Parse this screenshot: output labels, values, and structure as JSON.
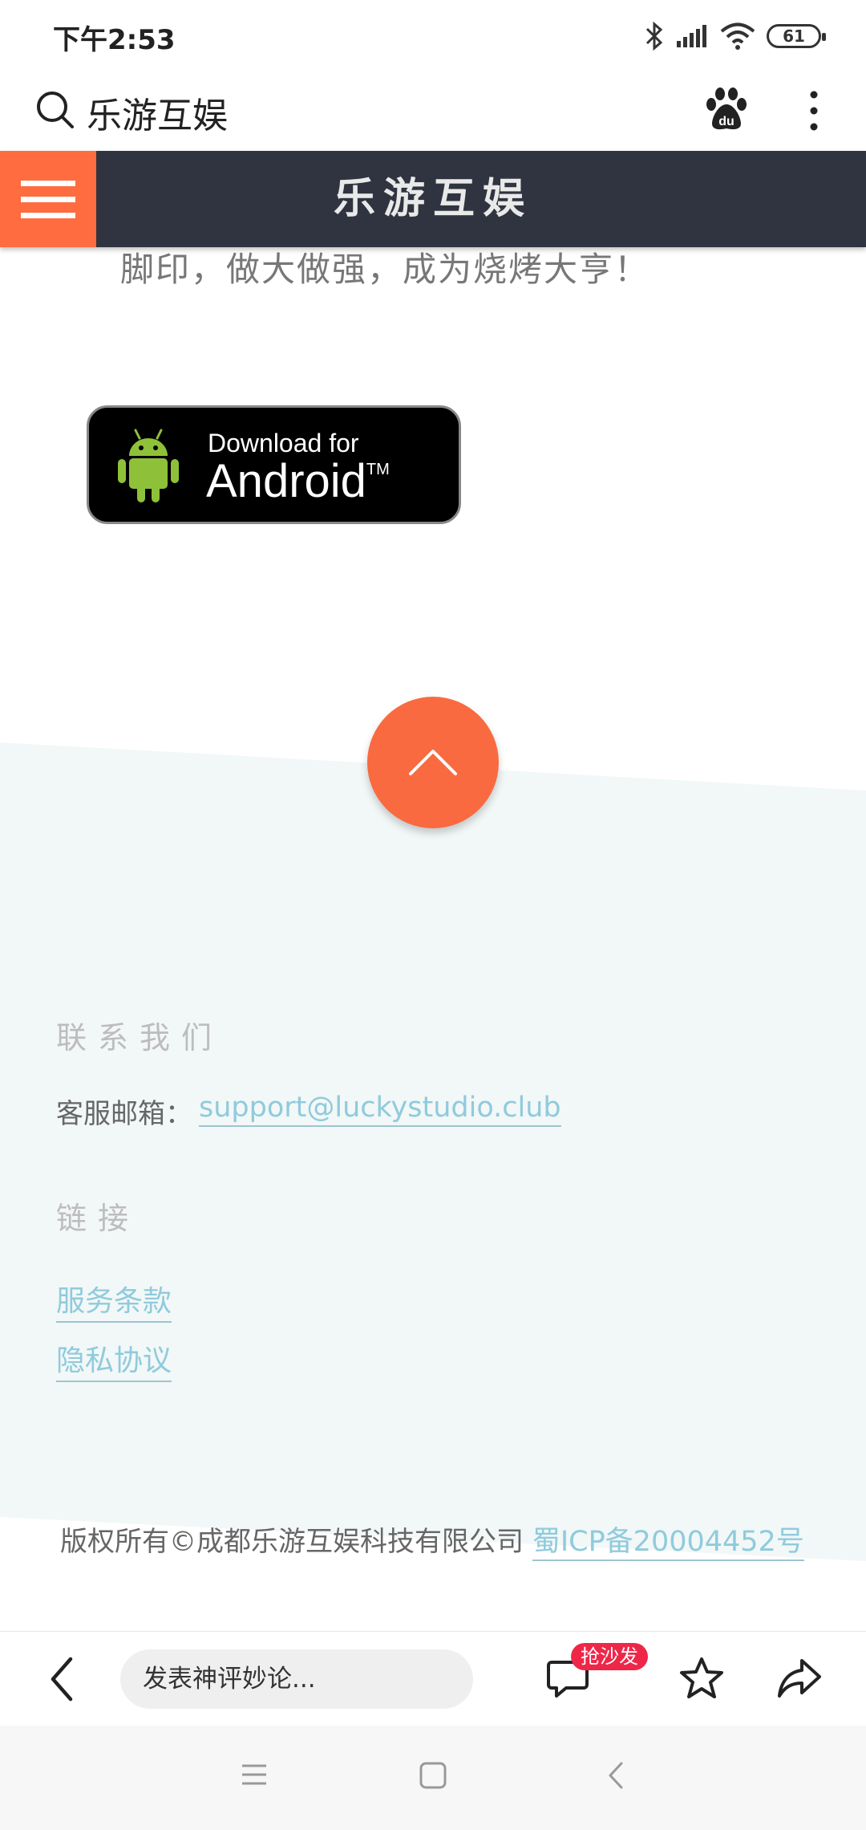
{
  "status_bar": {
    "time": "下午2:53",
    "battery": "61"
  },
  "search_bar": {
    "query": "乐游互娱"
  },
  "site_header": {
    "title": "乐游互娱"
  },
  "content": {
    "intro_text": "脚印，做大做强，成为烧烤大亨！",
    "android_badge": {
      "line1": "Download for",
      "line2": "Android",
      "tm": "TM"
    }
  },
  "footer": {
    "contact_title": "联系我们",
    "email_label": "客服邮箱：",
    "email": "support@luckystudio.club",
    "links_title": "链接",
    "links": [
      "服务条款",
      "隐私协议"
    ],
    "copyright": "版权所有©成都乐游互娱科技有限公司",
    "icp": "蜀ICP备20004452号"
  },
  "bottom_toolbar": {
    "comment_placeholder": "发表神评妙论...",
    "sofa_badge": "抢沙发"
  },
  "colors": {
    "accent": "#ff6c40",
    "header_bg": "#2f3440",
    "footer_bg": "#f2f7f7",
    "link": "#8fcbdc",
    "badge_red": "#ee2749"
  },
  "icons": [
    "search-icon",
    "baidu-paw-icon",
    "more-vertical-icon",
    "menu-icon",
    "android-robot-icon",
    "chevron-up-icon",
    "back-arrow-icon",
    "comment-icon",
    "star-icon",
    "share-icon",
    "nav-menu-icon",
    "nav-home-icon",
    "nav-back-icon",
    "bluetooth-icon",
    "signal-icon",
    "wifi-icon",
    "battery-icon"
  ]
}
